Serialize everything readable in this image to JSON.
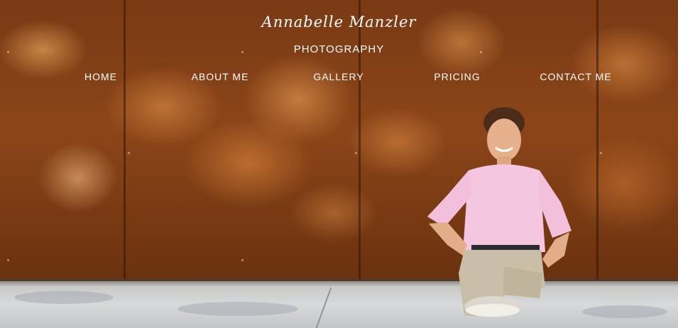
{
  "brand": {
    "name": "Annabelle Manzler",
    "tagline": "PHOTOGRAPHY"
  },
  "nav": {
    "items": [
      {
        "label": "HOME"
      },
      {
        "label": "ABOUT ME"
      },
      {
        "label": "GALLERY"
      },
      {
        "label": "PRICING"
      },
      {
        "label": "CONTACT ME"
      }
    ]
  },
  "hero": {
    "image_subject": "hero-photo"
  },
  "colors": {
    "text": "#ffffff",
    "wall": "#8b4518",
    "shirt": "#f4c6df",
    "pants": "#c9bfa8"
  }
}
